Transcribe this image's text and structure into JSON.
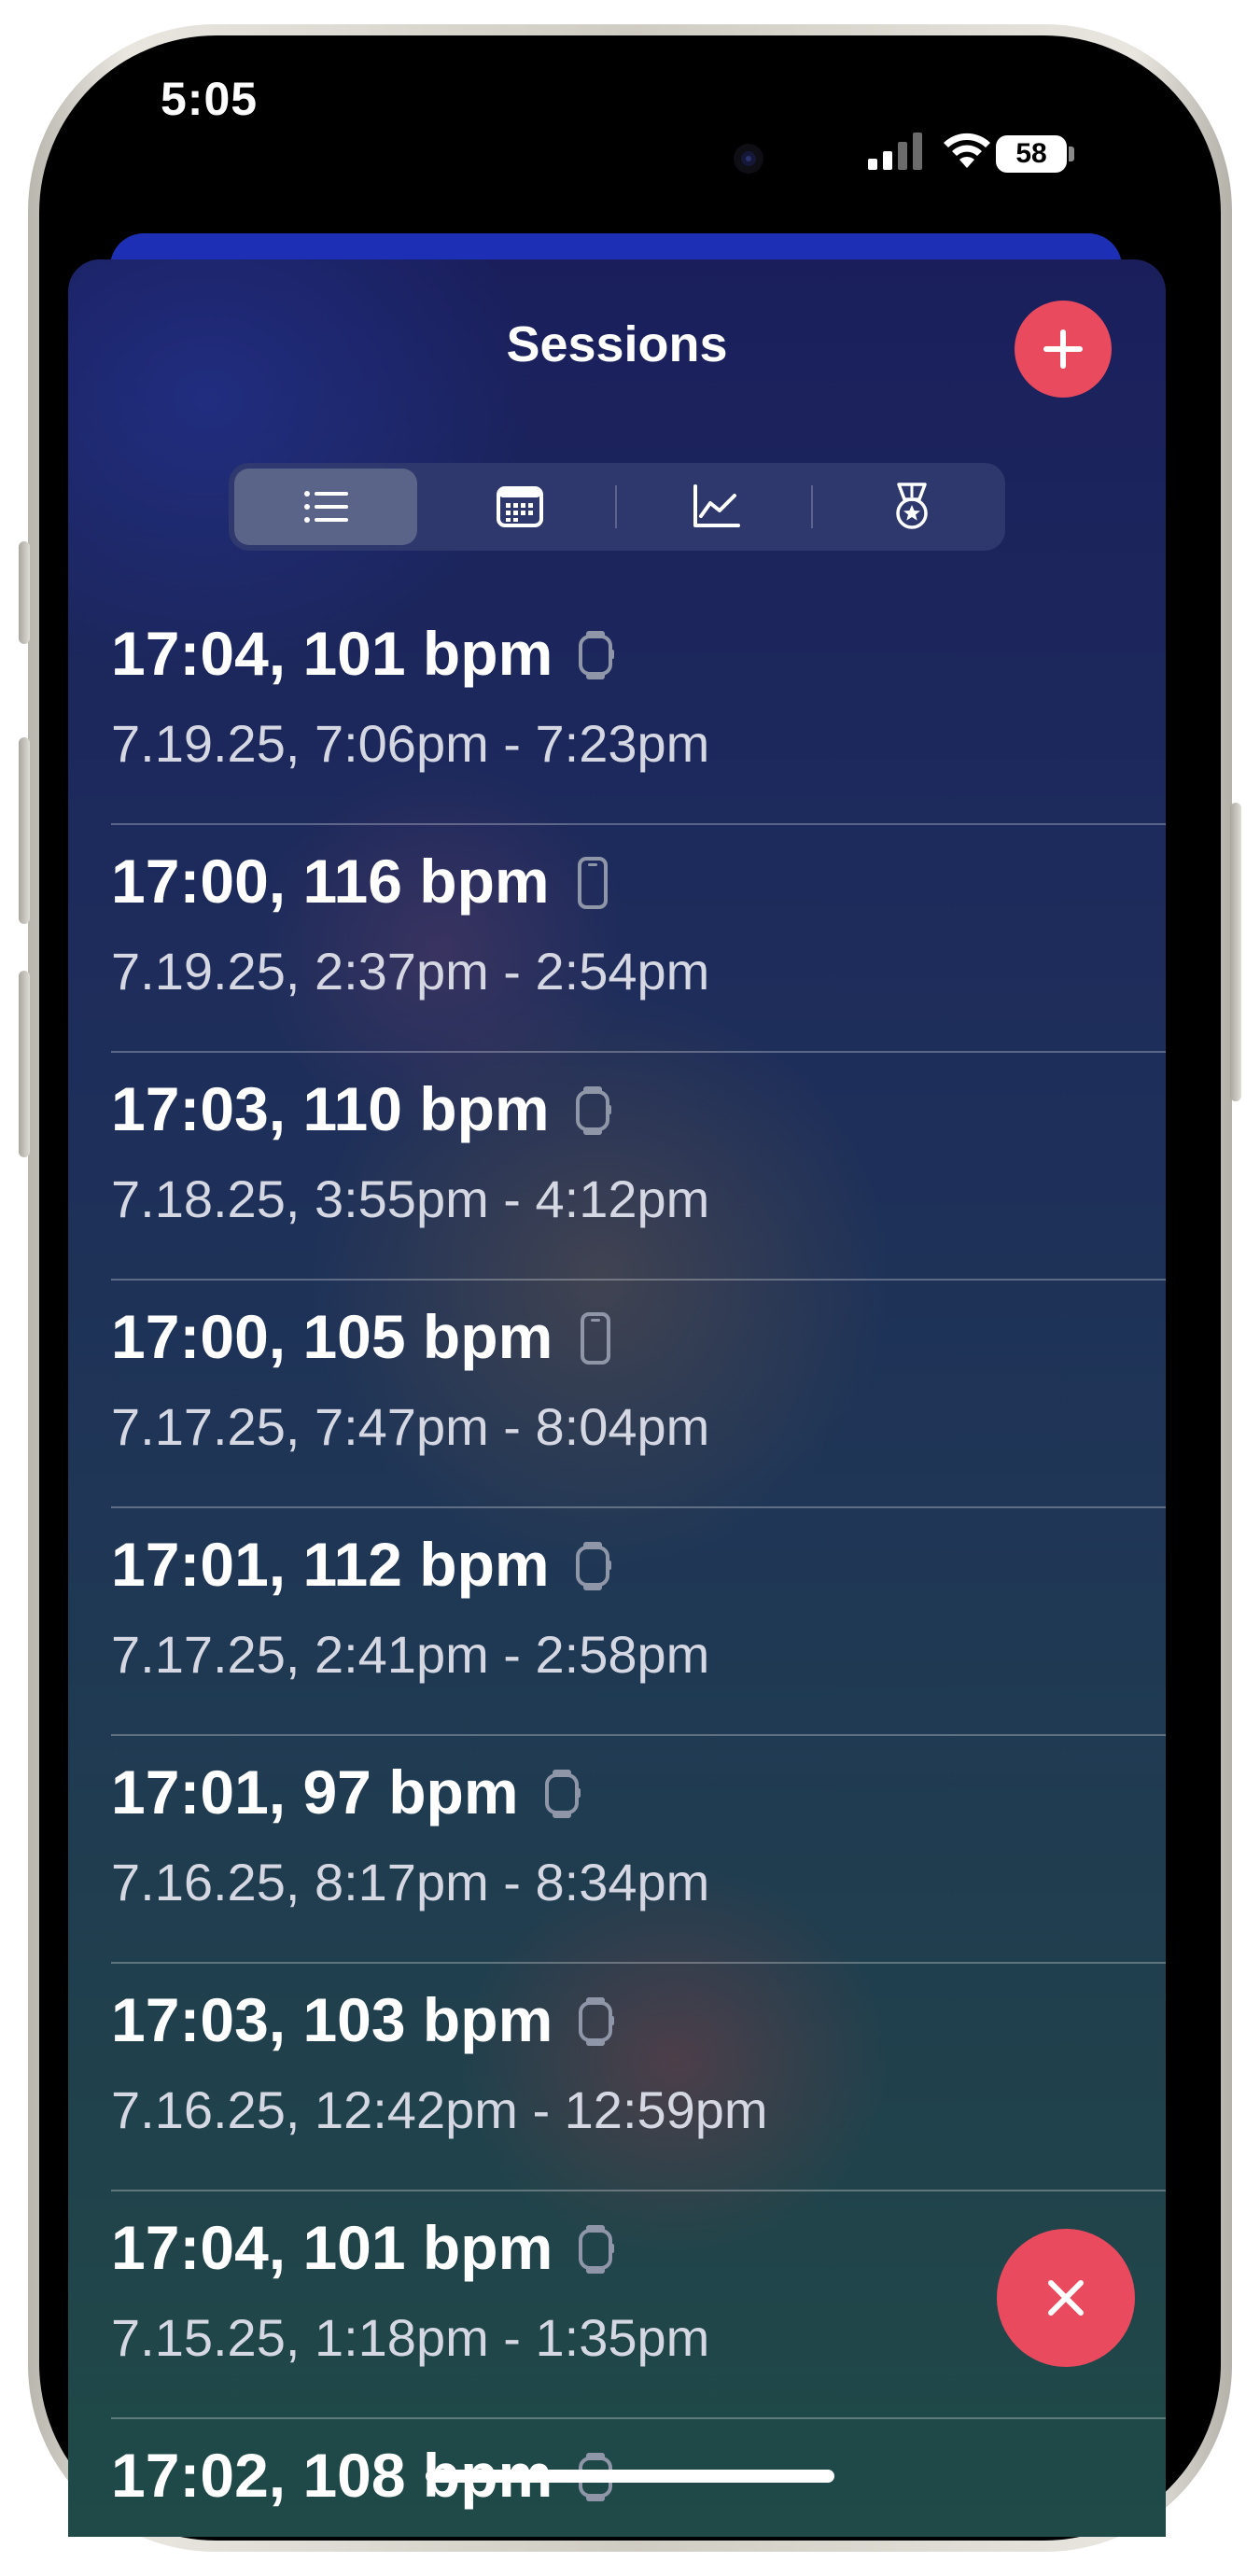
{
  "status_bar": {
    "time": "5:05",
    "battery": "58"
  },
  "sheet": {
    "title": "Sessions"
  },
  "segments": [
    {
      "name": "list-icon",
      "active": true
    },
    {
      "name": "calendar-icon",
      "active": false
    },
    {
      "name": "chart-icon",
      "active": false
    },
    {
      "name": "medal-icon",
      "active": false
    }
  ],
  "sessions": [
    {
      "title": "17:04, 101 bpm",
      "device": "watch-icon",
      "subtitle": "7.19.25, 7:06pm - 7:23pm"
    },
    {
      "title": "17:00, 116 bpm",
      "device": "phone-icon",
      "subtitle": "7.19.25, 2:37pm - 2:54pm"
    },
    {
      "title": "17:03, 110 bpm",
      "device": "watch-icon",
      "subtitle": "7.18.25, 3:55pm - 4:12pm"
    },
    {
      "title": "17:00, 105 bpm",
      "device": "phone-icon",
      "subtitle": "7.17.25, 7:47pm - 8:04pm"
    },
    {
      "title": "17:01, 112 bpm",
      "device": "watch-icon",
      "subtitle": "7.17.25, 2:41pm - 2:58pm"
    },
    {
      "title": "17:01, 97 bpm",
      "device": "watch-icon",
      "subtitle": "7.16.25, 8:17pm - 8:34pm"
    },
    {
      "title": "17:03, 103 bpm",
      "device": "watch-icon",
      "subtitle": "7.16.25, 12:42pm - 12:59pm"
    },
    {
      "title": "17:04, 101 bpm",
      "device": "watch-icon",
      "subtitle": "7.15.25, 1:18pm - 1:35pm"
    },
    {
      "title": "17:02, 108 bpm",
      "device": "watch-icon",
      "subtitle": ""
    }
  ],
  "colors": {
    "accent": "#e94a5e",
    "sheet_top": "#1a1f5c",
    "sheet_bottom": "#1f4a47",
    "segment_active": "#5a6388"
  }
}
